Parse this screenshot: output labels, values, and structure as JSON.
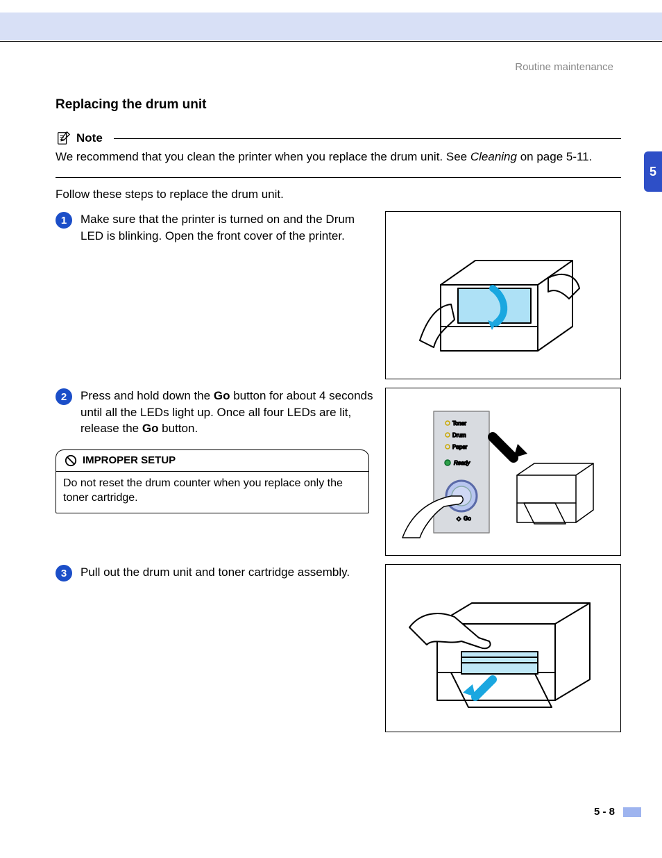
{
  "header": {
    "section": "Routine maintenance"
  },
  "tab": {
    "number": "5"
  },
  "title": "Replacing the drum unit",
  "note": {
    "label": "Note",
    "body_prefix": "We recommend that you clean the printer when you replace the drum unit. See ",
    "body_xref": "Cleaning",
    "body_suffix": " on page 5-11."
  },
  "intro": "Follow these steps to replace the drum unit.",
  "steps": [
    {
      "n": "1",
      "text": "Make sure that the printer is turned on and the Drum LED is blinking. Open the front cover of the printer."
    },
    {
      "n": "2",
      "text_parts": [
        "Press and hold down the ",
        "Go",
        " button for about 4 seconds until all the LEDs light up. Once all four LEDs are lit, release the ",
        "Go",
        " button."
      ]
    },
    {
      "n": "3",
      "text": "Pull out the drum unit and toner cartridge assembly."
    }
  ],
  "warning": {
    "title": "IMPROPER SETUP",
    "body": "Do not reset the drum counter when you replace only the toner cartridge."
  },
  "panel": {
    "led1": "Toner",
    "led2": "Drum",
    "led3": "Paper",
    "led4": "Ready",
    "btn": "Go"
  },
  "footer": {
    "page": "5 - 8"
  }
}
